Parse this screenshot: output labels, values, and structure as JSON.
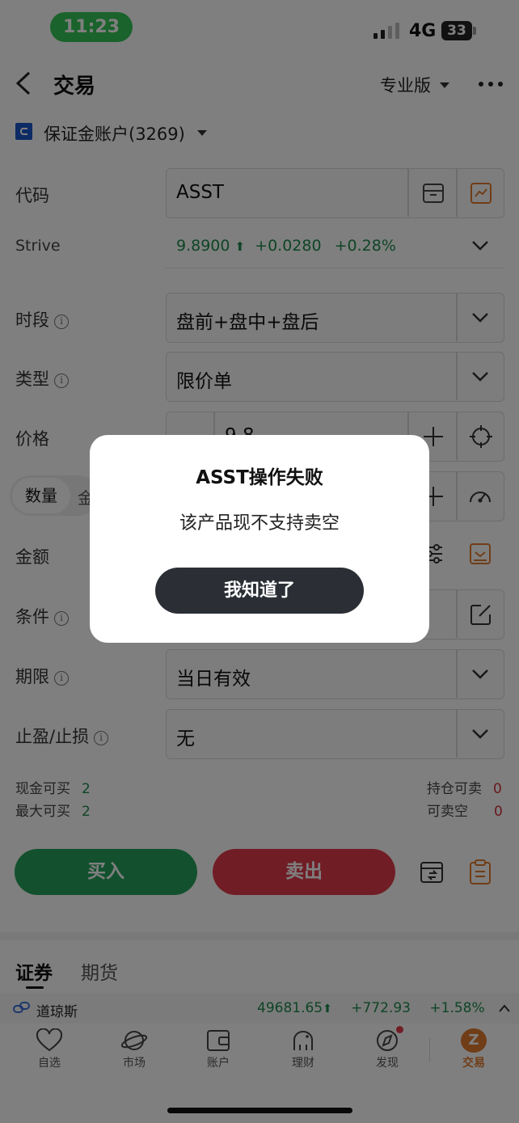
{
  "status_bar": {
    "time": "11:23",
    "network": "4G",
    "battery": "33"
  },
  "header": {
    "title": "交易",
    "pro_label": "专业版"
  },
  "account": {
    "label": "保证金账户(3269)"
  },
  "form": {
    "code": {
      "label": "代码",
      "value": "ASST"
    },
    "quote": {
      "name": "Strive",
      "price": "9.8900",
      "change": "+0.0280",
      "change_pct": "+0.28%"
    },
    "session": {
      "label": "时段",
      "value": "盘前+盘中+盘后"
    },
    "type": {
      "label": "类型",
      "value": "限价单"
    },
    "price": {
      "label": "价格",
      "value": "9.8"
    },
    "qty_toggle": {
      "qty": "数量",
      "amt": "金"
    },
    "amount": {
      "label": "金额"
    },
    "condition": {
      "label": "条件"
    },
    "validity": {
      "label": "期限",
      "value": "当日有效"
    },
    "tp_sl": {
      "label": "止盈/止损",
      "value": "无"
    }
  },
  "availability": {
    "cash_buy_label": "现金可买",
    "cash_buy_value": "2",
    "max_buy_label": "最大可买",
    "max_buy_value": "2",
    "pos_sell_label": "持仓可卖",
    "pos_sell_value": "0",
    "short_label": "可卖空",
    "short_value": "0"
  },
  "actions": {
    "buy": "买入",
    "sell": "卖出"
  },
  "bottom_tabs": {
    "securities": "证券",
    "futures": "期货"
  },
  "ticker": {
    "name": "道琼斯",
    "value": "49681.65",
    "change": "+772.93",
    "change_pct": "+1.58%"
  },
  "nav": [
    {
      "label": "自选",
      "icon": "heart-icon"
    },
    {
      "label": "市场",
      "icon": "planet-icon"
    },
    {
      "label": "账户",
      "icon": "wallet-icon"
    },
    {
      "label": "理财",
      "icon": "piggy-icon"
    },
    {
      "label": "发现",
      "icon": "compass-icon"
    },
    {
      "label": "交易",
      "icon": "trade-icon"
    }
  ],
  "colors": {
    "green": "#1f8a4c",
    "red": "#d2323c",
    "accent_orange": "#e07a2e"
  },
  "dialog": {
    "title": "ASST操作失败",
    "message": "该产品现不支持卖空",
    "button": "我知道了"
  }
}
